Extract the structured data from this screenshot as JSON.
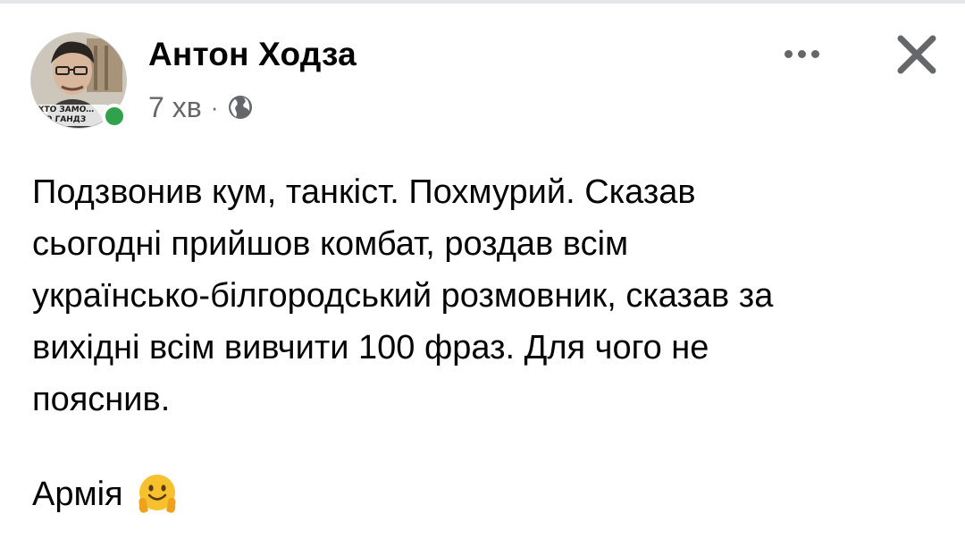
{
  "post": {
    "author": "Антон Ходза",
    "time": "7 хв",
    "separator": "·",
    "audience_icon": "globe-icon",
    "avatar_caption": "ХТО ЗАМО… ТЮ ГАНДЗ",
    "online": true,
    "body": "Подзвонив кум, танкіст. Похмурий. Сказав\nсьогодні прийшов комбат, роздав всім\nукраїнсько-білгородський розмовник, сказав за\nвихідні всім вивчити 100 фраз. Для чого не\nпояснив.",
    "signature": "Армія",
    "signature_emoji": "hugging-face-emoji"
  },
  "actions": {
    "more_icon": "more-horizontal-icon",
    "close_icon": "close-icon"
  },
  "colors": {
    "text": "#050505",
    "secondary_text": "#65676b",
    "online": "#31a24c",
    "background": "#ffffff"
  }
}
